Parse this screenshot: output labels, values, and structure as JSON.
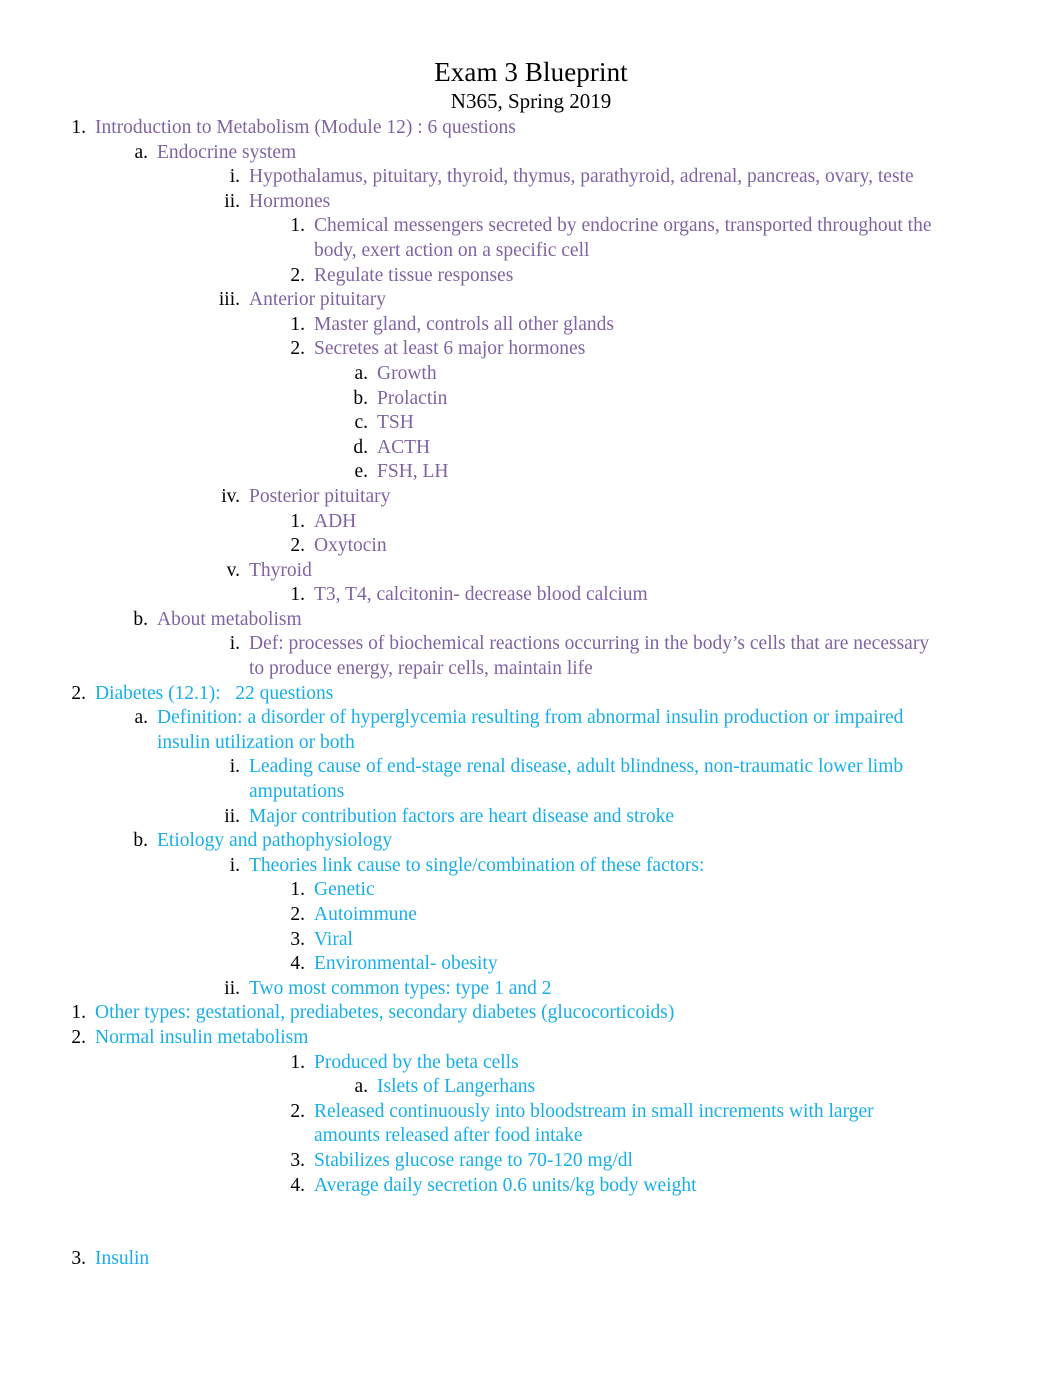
{
  "document": {
    "title": "Exam 3 Blueprint",
    "subtitle": "N365, Spring 2019"
  },
  "colors": {
    "purple": "#8064A2",
    "cyan": "#18AEE8",
    "marker": "#000000",
    "title": "#000000",
    "background": "#FFFFFF"
  },
  "outline": [
    {
      "marker": "1.",
      "level": 1,
      "color": "purple",
      "text": "Introduction to Metabolism (Module 12) : 6 questions"
    },
    {
      "marker": "a.",
      "level": 2,
      "color": "purple",
      "text": "Endocrine system"
    },
    {
      "marker": "i.",
      "level": 3,
      "color": "purple",
      "text": "Hypothalamus, pituitary, thyroid, thymus, parathyroid, adrenal, pancreas, ovary, teste"
    },
    {
      "marker": "ii.",
      "level": 3,
      "color": "purple",
      "text": "Hormones"
    },
    {
      "marker": "1.",
      "level": 4,
      "color": "purple",
      "text": "Chemical messengers secreted by endocrine organs, transported throughout the body, exert action on a specific cell"
    },
    {
      "marker": "2.",
      "level": 4,
      "color": "purple",
      "text": "Regulate tissue responses"
    },
    {
      "marker": "iii.",
      "level": 3,
      "color": "purple",
      "text": "Anterior pituitary"
    },
    {
      "marker": "1.",
      "level": 4,
      "color": "purple",
      "text": "Master gland, controls all other glands"
    },
    {
      "marker": "2.",
      "level": 4,
      "color": "purple",
      "text": "Secretes at least 6 major hormones"
    },
    {
      "marker": "a.",
      "level": 5,
      "color": "purple",
      "text": "Growth"
    },
    {
      "marker": "b.",
      "level": 5,
      "color": "purple",
      "text": "Prolactin"
    },
    {
      "marker": "c.",
      "level": 5,
      "color": "purple",
      "text": "TSH"
    },
    {
      "marker": "d.",
      "level": 5,
      "color": "purple",
      "text": "ACTH"
    },
    {
      "marker": "e.",
      "level": 5,
      "color": "purple",
      "text": "FSH, LH"
    },
    {
      "marker": "iv.",
      "level": 3,
      "color": "purple",
      "text": "Posterior pituitary"
    },
    {
      "marker": "1.",
      "level": 4,
      "color": "purple",
      "text": "ADH"
    },
    {
      "marker": "2.",
      "level": 4,
      "color": "purple",
      "text": "Oxytocin"
    },
    {
      "marker": "v.",
      "level": 3,
      "color": "purple",
      "text": "Thyroid"
    },
    {
      "marker": "1.",
      "level": 4,
      "color": "purple",
      "text": "T3, T4, calcitonin- decrease blood calcium"
    },
    {
      "marker": "b.",
      "level": 2,
      "color": "purple",
      "text": "About metabolism"
    },
    {
      "marker": "i.",
      "level": 3,
      "color": "purple",
      "text": "Def: processes of biochemical reactions occurring in the body’s cells that are necessary to produce energy, repair cells, maintain life"
    },
    {
      "marker": "2.",
      "level": 1,
      "color": "cyan",
      "text": "Diabetes (12.1):   22 questions"
    },
    {
      "marker": "a.",
      "level": 2,
      "color": "cyan",
      "text": "Definition: a disorder of hyperglycemia resulting from abnormal insulin production or impaired insulin utilization or both"
    },
    {
      "marker": "i.",
      "level": 3,
      "color": "cyan",
      "text": "Leading cause of end-stage renal disease, adult blindness, non-traumatic lower limb amputations"
    },
    {
      "marker": "ii.",
      "level": 3,
      "color": "cyan",
      "text": "Major contribution factors are heart disease and stroke"
    },
    {
      "marker": "b.",
      "level": 2,
      "color": "cyan",
      "text": "Etiology and pathophysiology"
    },
    {
      "marker": "i.",
      "level": 3,
      "color": "cyan",
      "text": "Theories link cause to single/combination of these factors:"
    },
    {
      "marker": "1.",
      "level": 4,
      "color": "cyan",
      "text": "Genetic"
    },
    {
      "marker": "2.",
      "level": 4,
      "color": "cyan",
      "text": "Autoimmune"
    },
    {
      "marker": "3.",
      "level": 4,
      "color": "cyan",
      "text": "Viral"
    },
    {
      "marker": "4.",
      "level": 4,
      "color": "cyan",
      "text": "Environmental- obesity"
    },
    {
      "marker": "ii.",
      "level": 3,
      "color": "cyan",
      "text": "Two most common types: type 1 and 2"
    },
    {
      "marker": "1.",
      "level": 1,
      "color": "cyan",
      "text": "Other types: gestational, prediabetes, secondary diabetes (glucocorticoids)"
    },
    {
      "marker": "2.",
      "level": 1,
      "color": "cyan",
      "text": "Normal insulin metabolism"
    },
    {
      "marker": "1.",
      "level": 4,
      "color": "cyan",
      "text": "Produced by the beta cells"
    },
    {
      "marker": "a.",
      "level": 5,
      "color": "cyan",
      "text": "Islets of Langerhans"
    },
    {
      "marker": "2.",
      "level": 4,
      "color": "cyan",
      "text": "Released continuously into bloodstream in small increments with larger amounts released after food intake"
    },
    {
      "marker": "3.",
      "level": 4,
      "color": "cyan",
      "text": "Stabilizes glucose range to 70-120 mg/dl"
    },
    {
      "marker": "4.",
      "level": 4,
      "color": "cyan",
      "text": "Average daily secretion 0.6 units/kg body weight"
    },
    {
      "marker": "",
      "level": 1,
      "color": "cyan",
      "text": "",
      "blank": true
    },
    {
      "marker": "",
      "level": 1,
      "color": "cyan",
      "text": "",
      "blank": true
    },
    {
      "marker": "3.",
      "level": 1,
      "color": "cyan",
      "text": "Insulin"
    }
  ]
}
